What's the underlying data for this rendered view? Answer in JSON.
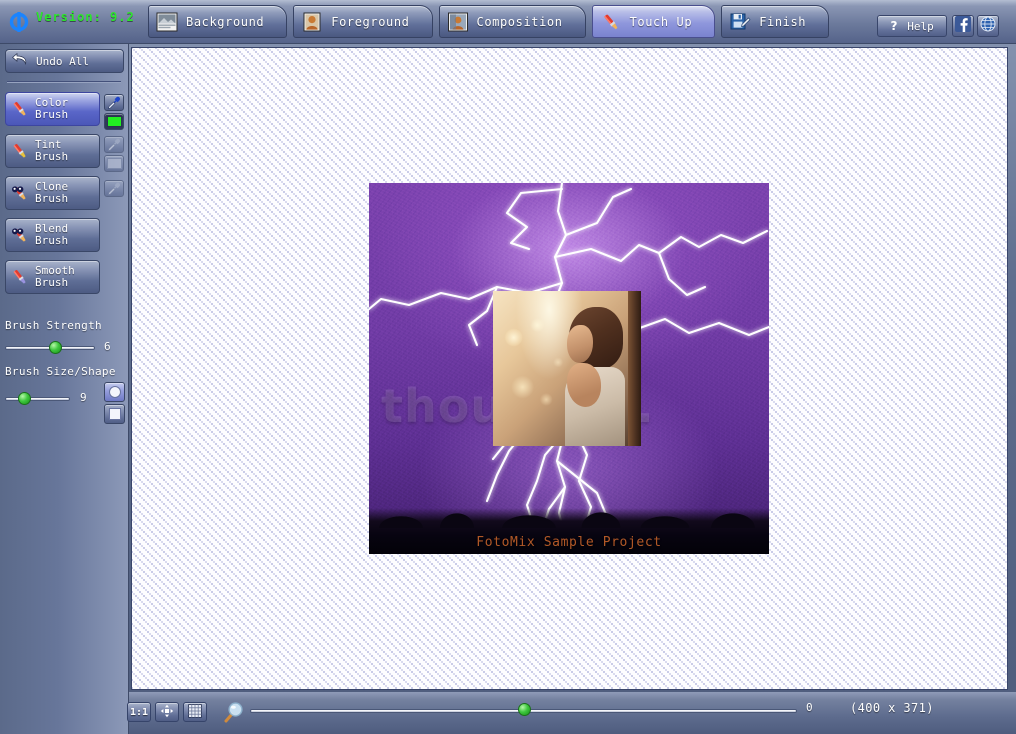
{
  "app": {
    "logo_icon": "fotomix-logo-icon",
    "version_label": "Version: 9.2"
  },
  "tabs": [
    {
      "label": "Background",
      "icon": "landscape-photo-icon",
      "active": false
    },
    {
      "label": "Foreground",
      "icon": "portrait-photo-icon",
      "active": false
    },
    {
      "label": "Composition",
      "icon": "composition-photo-icon",
      "active": false
    },
    {
      "label": "Touch Up",
      "icon": "brush-icon",
      "active": true
    },
    {
      "label": "Finish",
      "icon": "save-pencil-icon",
      "active": false
    }
  ],
  "header": {
    "help_label": "Help",
    "help_icon": "question-mark-icon",
    "facebook_icon": "facebook-icon",
    "web_icon": "globe-icon"
  },
  "sidebar": {
    "undo_all_label": "Undo All",
    "undo_icon": "undo-arrow-icon",
    "tools": [
      {
        "line1": "Color",
        "line2": "Brush",
        "icon": "color-brush-icon",
        "selected": true
      },
      {
        "line1": "Tint",
        "line2": "Brush",
        "icon": "tint-brush-icon",
        "selected": false
      },
      {
        "line1": "Clone",
        "line2": "Brush",
        "icon": "clone-brush-icon",
        "selected": false
      },
      {
        "line1": "Blend",
        "line2": "Brush",
        "icon": "blend-brush-icon",
        "selected": false
      },
      {
        "line1": "Smooth",
        "line2": "Brush",
        "icon": "smooth-brush-icon",
        "selected": false
      }
    ],
    "side_controls": [
      {
        "icon": "eyedropper-icon",
        "enabled": true
      },
      {
        "icon": "color-swatch",
        "enabled": true,
        "color": "#22ee22"
      },
      {
        "icon": "eyedropper-icon",
        "enabled": false
      },
      {
        "icon": "color-swatch",
        "enabled": false,
        "color": "#c3cadd"
      },
      {
        "icon": "eyedropper-icon",
        "enabled": false
      }
    ],
    "brush_strength": {
      "label": "Brush Strength",
      "value": "6",
      "percent": 53
    },
    "brush_size": {
      "label": "Brush Size/Shape",
      "value": "9",
      "percent": 22
    },
    "shapes": [
      {
        "icon": "round-brush-shape-icon",
        "selected": true
      },
      {
        "icon": "square-brush-shape-icon",
        "selected": false
      }
    ]
  },
  "canvas": {
    "artwork": {
      "watermark_text": "thou…ot…",
      "caption_text": "FotoMix Sample Project",
      "background_description": "purple-lightning-storm",
      "overlay_description": "child-photo"
    }
  },
  "bottombar": {
    "buttons": [
      {
        "label": "1:1",
        "icon": "actual-size-icon"
      },
      {
        "label": "",
        "icon": "fit-to-window-icon"
      },
      {
        "label": "",
        "icon": "grid-icon"
      }
    ],
    "magnifier_icon": "magnifier-icon",
    "zoom_value": "0",
    "zoom_percent": 49,
    "dimensions": "(400 x 371)"
  }
}
